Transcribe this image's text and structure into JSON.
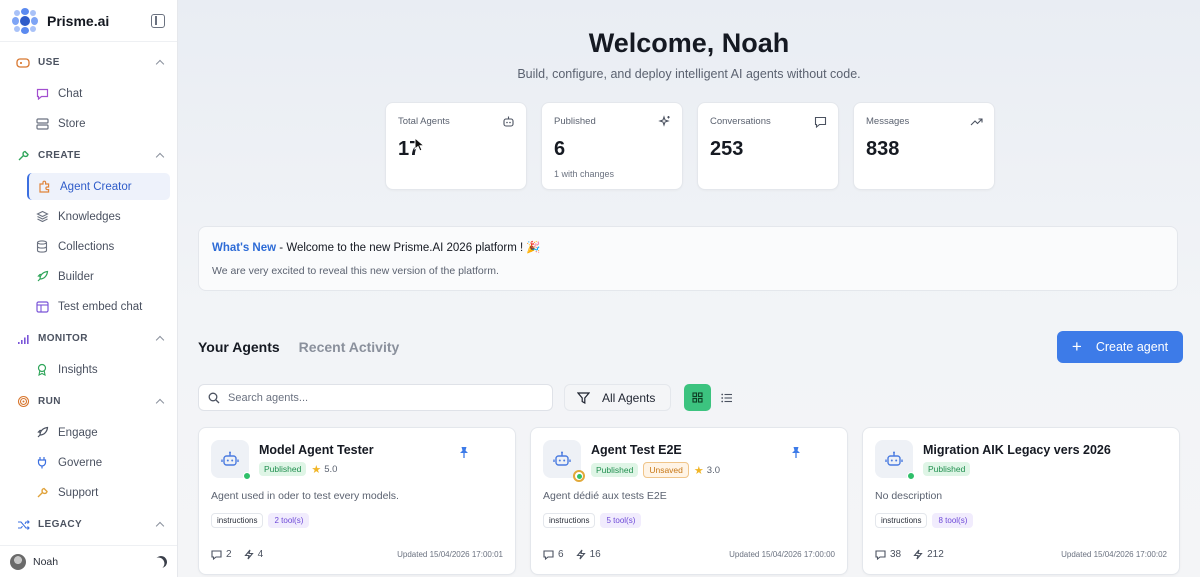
{
  "brand": {
    "name": "Prisme.ai"
  },
  "sidebar": {
    "sections": [
      {
        "title": "USE",
        "icon": "gamepad-icon",
        "items": [
          {
            "label": "Chat",
            "icon": "chat-icon"
          },
          {
            "label": "Store",
            "icon": "store-icon"
          }
        ]
      },
      {
        "title": "CREATE",
        "icon": "wrench-icon",
        "items": [
          {
            "label": "Agent Creator",
            "icon": "puzzle-icon",
            "active": true
          },
          {
            "label": "Knowledges",
            "icon": "layers-icon"
          },
          {
            "label": "Collections",
            "icon": "database-icon"
          },
          {
            "label": "Builder",
            "icon": "rocket-icon"
          },
          {
            "label": "Test embed chat",
            "icon": "layout-icon"
          }
        ]
      },
      {
        "title": "MONITOR",
        "icon": "signal-icon",
        "items": [
          {
            "label": "Insights",
            "icon": "award-icon"
          }
        ]
      },
      {
        "title": "RUN",
        "icon": "fingerprint-icon",
        "items": [
          {
            "label": "Engage",
            "icon": "rocket-icon"
          },
          {
            "label": "Governe",
            "icon": "plug-icon"
          },
          {
            "label": "Support",
            "icon": "wrench-icon"
          }
        ]
      },
      {
        "title": "LEGACY",
        "icon": "shuffle-icon",
        "items": []
      }
    ],
    "user": {
      "name": "Noah"
    }
  },
  "header": {
    "title": "Welcome, Noah",
    "subtitle": "Build, configure, and deploy intelligent AI agents without code."
  },
  "stats": [
    {
      "label": "Total Agents",
      "value": "17",
      "note": "",
      "icon": "bot-icon"
    },
    {
      "label": "Published",
      "value": "6",
      "note": "1 with changes",
      "icon": "sparkles-icon"
    },
    {
      "label": "Conversations",
      "value": "253",
      "note": "",
      "icon": "message-icon"
    },
    {
      "label": "Messages",
      "value": "838",
      "note": "",
      "icon": "trending-up-icon"
    }
  ],
  "news": {
    "tag": "What's New",
    "separator": " - ",
    "headline": "Welcome to the new Prisme.AI 2026 platform ! 🎉",
    "body": "We are very excited to reveal this new version of the platform."
  },
  "tabs": [
    {
      "label": "Your Agents",
      "active": true
    },
    {
      "label": "Recent Activity",
      "active": false
    }
  ],
  "create_button": {
    "plus": "+",
    "label": "Create agent"
  },
  "search": {
    "placeholder": "Search agents...",
    "value": ""
  },
  "filter": {
    "label": "All Agents"
  },
  "colors": {
    "accent": "#3d7be8",
    "success": "#3cc37f",
    "warning": "#e2a93a"
  },
  "agents": [
    {
      "name": "Model Agent Tester",
      "status": "Published",
      "unsaved": "",
      "rating": "5.0",
      "pinned": true,
      "description": "Agent used in oder to test every models.",
      "tags": [
        "instructions",
        "2 tool(s)"
      ],
      "conversations": "2",
      "actions": "4",
      "updated": "Updated 15/04/2026 17:00:01",
      "dot": "green"
    },
    {
      "name": "Agent Test E2E",
      "status": "Published",
      "unsaved": "Unsaved",
      "rating": "3.0",
      "pinned": true,
      "description": "Agent dédié aux tests E2E",
      "tags": [
        "instructions",
        "5 tool(s)"
      ],
      "conversations": "6",
      "actions": "16",
      "updated": "Updated 15/04/2026 17:00:00",
      "dot": "ring"
    },
    {
      "name": "Migration AIK Legacy vers 2026",
      "status": "Published",
      "unsaved": "",
      "rating": "",
      "pinned": false,
      "description": "No description",
      "tags": [
        "instructions",
        "8 tool(s)"
      ],
      "conversations": "38",
      "actions": "212",
      "updated": "Updated 15/04/2026 17:00:02",
      "dot": "green"
    }
  ]
}
